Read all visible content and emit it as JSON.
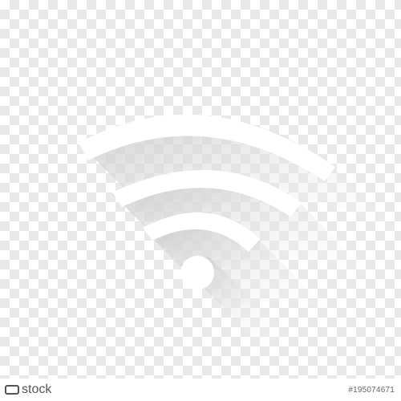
{
  "image": {
    "subject": "wifi-icon",
    "icon_color": "#ffffff",
    "shadow_color": "#d9d9d9",
    "background": "transparency-checkerboard"
  },
  "stock": {
    "logo_text": "stock",
    "logo_icon": "adobe-stock-mark",
    "image_id": "#195074671"
  }
}
